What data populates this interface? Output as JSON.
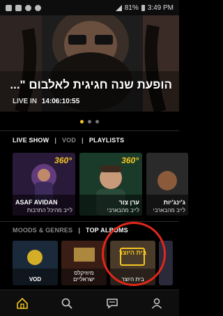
{
  "status_bar": {
    "battery": "81%",
    "time": "3:49 PM"
  },
  "hero": {
    "title": "הופעת שנה חגיגית לאלבום \"...",
    "live_label": "LIVE IN",
    "countdown": "14:06:10:55"
  },
  "carousel": {
    "active_index": 0,
    "count": 3
  },
  "section1": {
    "tabs": [
      {
        "label": "LIVE SHOW",
        "active": true
      },
      {
        "label": "VOD",
        "active": false
      },
      {
        "label": "PLAYLISTS",
        "active": true
      }
    ],
    "cards": [
      {
        "badge": "360°",
        "title": "ASAF AVIDAN",
        "subtitle": "לייב מהיכל התרבות"
      },
      {
        "badge": "360°",
        "title": "ערן צור",
        "subtitle": "לייב מהבארבי"
      },
      {
        "badge": "",
        "title": "ג'ינג'יות",
        "subtitle": "לייב מהבארבי"
      }
    ]
  },
  "section2": {
    "tabs": [
      {
        "label": "MOODS & GENRES",
        "active": false
      },
      {
        "label": "TOP ALBUMS",
        "active": true
      }
    ],
    "tiles": [
      {
        "label": "VOD"
      },
      {
        "label": "מיוזיקלס ישראליים"
      },
      {
        "label": "בית היוצר",
        "overlay": "בית היוצר"
      },
      {
        "label": ""
      }
    ]
  },
  "bottom_nav": [
    "home-icon",
    "search-icon",
    "chat-icon",
    "profile-icon"
  ],
  "colors": {
    "accent": "#f3c623",
    "highlight_circle": "#e3271b"
  }
}
